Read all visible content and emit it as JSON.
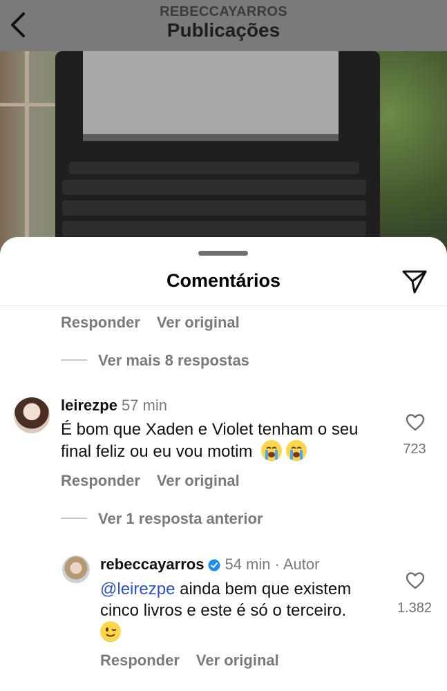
{
  "header": {
    "account": "REBECCAYARROS",
    "title": "Publicações"
  },
  "sheet": {
    "title": "Comentários"
  },
  "actions": {
    "reply": "Responder",
    "original": "Ver original"
  },
  "threads": {
    "more_replies_1": "Ver mais 8 respostas",
    "previous_reply": "Ver 1 resposta anterior"
  },
  "comments": [
    {
      "username": "leirezpe",
      "time": "57 min",
      "text": "É bom que Xaden e Violet tenham o seu final feliz ou eu vou motim",
      "emoji": [
        "loudly-crying-face",
        "loudly-crying-face"
      ],
      "likes": "723"
    },
    {
      "username": "rebeccayarros",
      "time": "54 min · Autor",
      "verified": true,
      "mention": "@leirezpe",
      "text": "ainda bem que existem cinco livros e este é só o terceiro.",
      "emoji": [
        "winking-face"
      ],
      "likes": "1.382"
    }
  ],
  "colors": {
    "mention": "#2b55c7",
    "secondary_text": "#7a7a7a",
    "verified": "#1d8cf0"
  }
}
